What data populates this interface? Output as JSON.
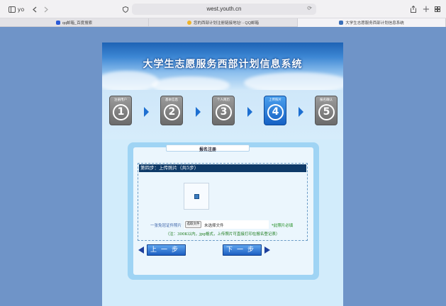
{
  "browser": {
    "profile_label": "yo",
    "url": "west.youth.cn",
    "tabs": [
      {
        "label": "qq邮箱_百度搜索",
        "active": false
      },
      {
        "label": "您的西部计划注册链接地址! - QQ邮箱",
        "active": false
      },
      {
        "label": "大学生志愿服务西部计划信息系统",
        "active": true
      }
    ]
  },
  "banner": {
    "title": "大学生志愿服务西部计划信息系统"
  },
  "steps": [
    {
      "label": "注册用户",
      "number": "1",
      "active": false
    },
    {
      "label": "基本信息",
      "number": "2",
      "active": false
    },
    {
      "label": "个人简历",
      "number": "3",
      "active": false
    },
    {
      "label": "上传照片",
      "number": "4",
      "active": true
    },
    {
      "label": "报名确认",
      "number": "5",
      "active": false
    }
  ],
  "form": {
    "panel_title": "报名注册",
    "step_heading": "第四步：上传照片（共5步）",
    "photo_label": "一张免冠证件照片",
    "file_button": "选取文件",
    "file_status": "未选择文件",
    "required_note": "*此照片必填",
    "hint": "（注：300K以内，jpg格式，上传照片可直接打印在报名登记表）",
    "prev_label": "上一步",
    "next_label": "下一步"
  },
  "colors": {
    "page_bg": "#6f94c8",
    "active_step": "#1661c4",
    "heading_bar": "#0e3a68",
    "required_green": "#1a8a1a"
  }
}
